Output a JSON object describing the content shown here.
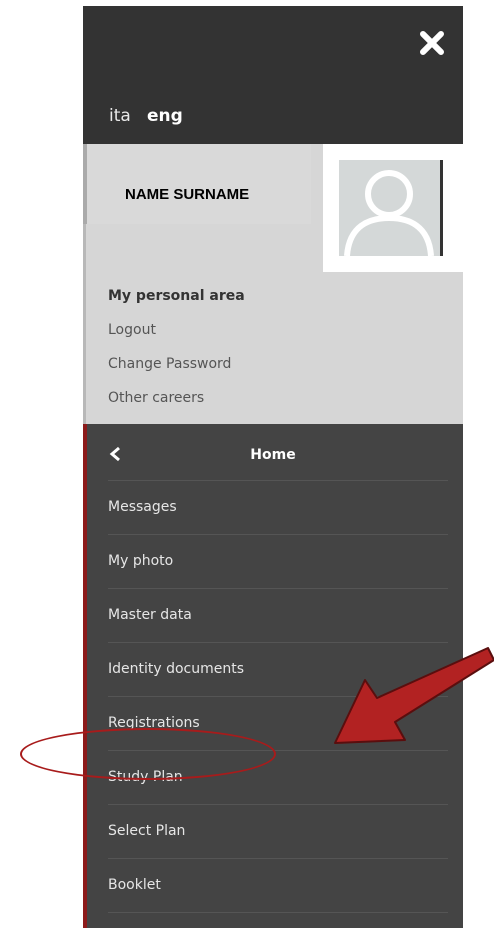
{
  "header": {
    "close_icon": "close-x-icon",
    "languages": [
      "ita",
      "eng"
    ],
    "active_language": "eng"
  },
  "user": {
    "name": "NAME SURNAME",
    "avatar_icon": "user-placeholder-icon"
  },
  "personal_area": {
    "title": "My personal area",
    "links": [
      "Logout",
      "Change Password",
      "Other careers"
    ]
  },
  "nav": {
    "back_icon": "chevron-left-icon",
    "home_label": "Home",
    "items": [
      "Messages",
      "My photo",
      "Master data",
      "Identity documents",
      "Registrations",
      "Study Plan",
      "Select Plan",
      "Booklet"
    ],
    "highlighted_item": "Study Plan"
  },
  "colors": {
    "panel_bg": "#444444",
    "top_bar_bg": "#333333",
    "user_block_bg": "#d6d6d6",
    "accent_red": "#8c1a1a",
    "annotation_red": "#a81b1b"
  }
}
